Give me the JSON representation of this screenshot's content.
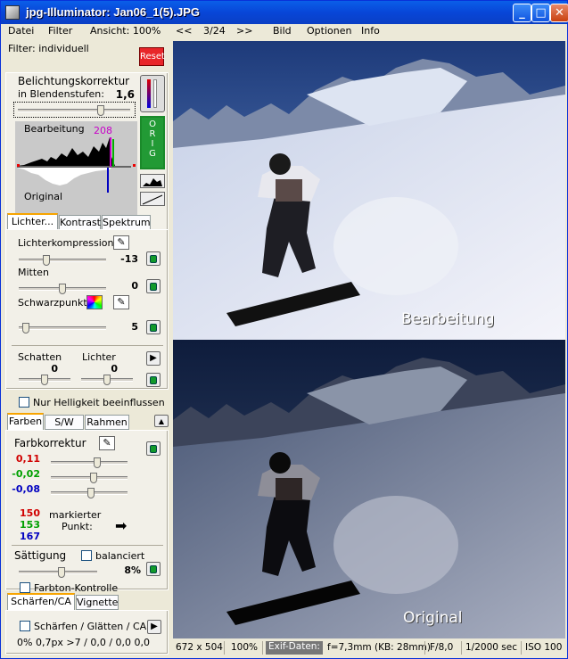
{
  "window": {
    "title": "jpg-Illuminator:   Jan06_1(5).JPG",
    "min": "_",
    "max": "□",
    "close": "✕"
  },
  "menu": {
    "datei": "Datei",
    "filter": "Filter",
    "ansicht": "Ansicht: 100%",
    "prev": "<<",
    "index": "3/24",
    "next": ">>",
    "bild": "Bild",
    "optionen": "Optionen",
    "info": "Info"
  },
  "filter_label": "Filter: individuell",
  "reset": "Reset",
  "exposure": {
    "title": "Belichtungskorrektur",
    "sub": "in Blendenstufen:",
    "value": "1,6",
    "slider_frac": 0.75
  },
  "histogram": {
    "label_top": "Bearbeitung",
    "label_bottom": "Original",
    "marker": "208",
    "orig_btn": "O R I G"
  },
  "tabs1": {
    "lichter": "Lichter...",
    "kontrast": "Kontrast",
    "spektrum": "Spektrum"
  },
  "lichter": {
    "kompression_label": "Lichterkompression",
    "kompression_value": "-13",
    "kompression_frac": 0.3,
    "mitten_label": "Mitten",
    "mitten_value": "0",
    "mitten_frac": 0.5,
    "schwarz_label": "Schwarzpunkt",
    "schwarz_value": "5",
    "schwarz_frac": 0.04,
    "schatten_label": "Schatten",
    "schatten_value": "0",
    "lichter2_label": "Lichter",
    "lichter2_value": "0",
    "nur_hell": "Nur Helligkeit beeinflussen"
  },
  "tabs2": {
    "farben": "Farben",
    "sw": "S/W",
    "rahmen": "Rahmen"
  },
  "farben": {
    "title": "Farbkorrektur",
    "r": "0,11",
    "g": "-0,02",
    "b": "-0,08",
    "r_frac": 0.62,
    "g_frac": 0.56,
    "b_frac": 0.52,
    "pr": "150",
    "pg": "153",
    "pb": "167",
    "markierter": "markierter",
    "punkt": "Punkt:",
    "arrow": "➡",
    "saettigung": "Sättigung",
    "balanciert": "balanciert",
    "saet_value": "8%",
    "saet_frac": 0.55,
    "farbton": "Farbton-Kontrolle",
    "color_red": "#d00000",
    "color_green": "#00a000",
    "color_blue": "#0000c0"
  },
  "tabs3": {
    "schaerfen": "Schärfen/CA",
    "vignette": "Vignette"
  },
  "schaerfen": {
    "label": "Schärfen / Glätten / CA",
    "params": "0%  0,7px  >7 / 0,0 / 0,0 0,0"
  },
  "photo": {
    "label_top": "Bearbeitung",
    "label_bottom": "Original"
  },
  "status": {
    "size": "672 x 504",
    "zoom": "100%",
    "exif": "Exif-Daten:",
    "focal": "f=7,3mm (KB: 28mm)",
    "aperture": "F/8,0",
    "shutter": "1/2000 sec",
    "iso": "ISO 100"
  }
}
